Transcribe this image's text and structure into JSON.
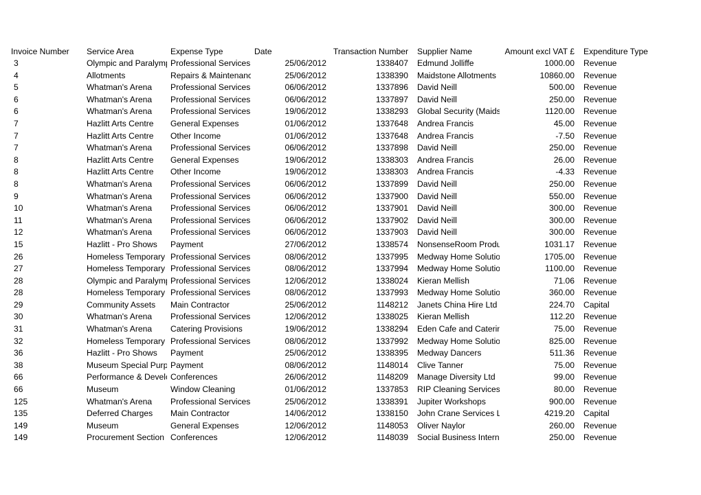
{
  "sheet": {
    "columns": [
      {
        "key": "invoice_number",
        "label": "Invoice Number",
        "align": "left"
      },
      {
        "key": "service_area",
        "label": "Service Area",
        "align": "left"
      },
      {
        "key": "expense_type",
        "label": "Expense Type",
        "align": "left"
      },
      {
        "key": "date",
        "label": "Date",
        "align": "right"
      },
      {
        "key": "transaction_no",
        "label": "Transaction Number",
        "align": "right"
      },
      {
        "key": "supplier_name",
        "label": "Supplier Name",
        "align": "left"
      },
      {
        "key": "amount_excl_vat",
        "label": "Amount excl VAT £",
        "align": "right"
      },
      {
        "key": "expenditure_type",
        "label": "Expenditure Type",
        "align": "left"
      }
    ],
    "rows": [
      [
        "3",
        "Olympic and Paralympic",
        "Professional Services",
        "25/06/2012",
        "1338407",
        "Edmund Jolliffe",
        "1000.00",
        "Revenue"
      ],
      [
        "4",
        "Allotments",
        "Repairs & Maintenance",
        "25/06/2012",
        "1338390",
        "Maidstone Allotments",
        "10860.00",
        "Revenue"
      ],
      [
        "5",
        "Whatman's Arena",
        "Professional Services",
        "06/06/2012",
        "1337896",
        "David Neill",
        "500.00",
        "Revenue"
      ],
      [
        "6",
        "Whatman's Arena",
        "Professional Services",
        "06/06/2012",
        "1337897",
        "David Neill",
        "250.00",
        "Revenue"
      ],
      [
        "6",
        "Whatman's Arena",
        "Professional Services",
        "19/06/2012",
        "1338293",
        "Global Security (Maidstone)",
        "1120.00",
        "Revenue"
      ],
      [
        "7",
        "Hazlitt Arts Centre",
        "General Expenses",
        "01/06/2012",
        "1337648",
        "Andrea Francis",
        "45.00",
        "Revenue"
      ],
      [
        "7",
        "Hazlitt Arts Centre",
        "Other Income",
        "01/06/2012",
        "1337648",
        "Andrea Francis",
        "-7.50",
        "Revenue"
      ],
      [
        "7",
        "Whatman's Arena",
        "Professional Services",
        "06/06/2012",
        "1337898",
        "David Neill",
        "250.00",
        "Revenue"
      ],
      [
        "8",
        "Hazlitt Arts Centre",
        "General Expenses",
        "19/06/2012",
        "1338303",
        "Andrea Francis",
        "26.00",
        "Revenue"
      ],
      [
        "8",
        "Hazlitt Arts Centre",
        "Other Income",
        "19/06/2012",
        "1338303",
        "Andrea Francis",
        "-4.33",
        "Revenue"
      ],
      [
        "8",
        "Whatman's Arena",
        "Professional Services",
        "06/06/2012",
        "1337899",
        "David Neill",
        "250.00",
        "Revenue"
      ],
      [
        "9",
        "Whatman's Arena",
        "Professional Services",
        "06/06/2012",
        "1337900",
        "David Neill",
        "550.00",
        "Revenue"
      ],
      [
        "10",
        "Whatman's Arena",
        "Professional Services",
        "06/06/2012",
        "1337901",
        "David Neill",
        "300.00",
        "Revenue"
      ],
      [
        "11",
        "Whatman's Arena",
        "Professional Services",
        "06/06/2012",
        "1337902",
        "David Neill",
        "300.00",
        "Revenue"
      ],
      [
        "12",
        "Whatman's Arena",
        "Professional Services",
        "06/06/2012",
        "1337903",
        "David Neill",
        "300.00",
        "Revenue"
      ],
      [
        "15",
        "Hazlitt - Pro Shows",
        "Payment",
        "27/06/2012",
        "1338574",
        "NonsenseRoom Productions",
        "1031.17",
        "Revenue"
      ],
      [
        "26",
        "Homeless Temporary",
        "Professional Services",
        "08/06/2012",
        "1337995",
        "Medway Home Solutions",
        "1705.00",
        "Revenue"
      ],
      [
        "27",
        "Homeless Temporary",
        "Professional Services",
        "08/06/2012",
        "1337994",
        "Medway Home Solutions",
        "1100.00",
        "Revenue"
      ],
      [
        "28",
        "Olympic and Paralympic",
        "Professional Services",
        "12/06/2012",
        "1338024",
        "Kieran Mellish",
        "71.06",
        "Revenue"
      ],
      [
        "28",
        "Homeless Temporary",
        "Professional Services",
        "08/06/2012",
        "1337993",
        "Medway Home Solutions",
        "360.00",
        "Revenue"
      ],
      [
        "29",
        "Community Assets",
        "Main Contractor",
        "25/06/2012",
        "1148212",
        "Janets China Hire Ltd",
        "224.70",
        "Capital"
      ],
      [
        "30",
        "Whatman's Arena",
        "Professional Services",
        "12/06/2012",
        "1338025",
        "Kieran Mellish",
        "112.20",
        "Revenue"
      ],
      [
        "31",
        "Whatman's Arena",
        "Catering Provisions",
        "19/06/2012",
        "1338294",
        "Eden Cafe and Catering",
        "75.00",
        "Revenue"
      ],
      [
        "32",
        "Homeless Temporary",
        "Professional Services",
        "08/06/2012",
        "1337992",
        "Medway Home Solutions",
        "825.00",
        "Revenue"
      ],
      [
        "36",
        "Hazlitt - Pro Shows",
        "Payment",
        "25/06/2012",
        "1338395",
        "Medway Dancers",
        "511.36",
        "Revenue"
      ],
      [
        "38",
        "Museum Special Purpose",
        "Payment",
        "08/06/2012",
        "1148014",
        "Clive Tanner",
        "75.00",
        "Revenue"
      ],
      [
        "66",
        "Performance & Development",
        "Conferences",
        "26/06/2012",
        "1148209",
        "Manage Diversity Ltd",
        "99.00",
        "Revenue"
      ],
      [
        "66",
        "Museum",
        "Window Cleaning",
        "01/06/2012",
        "1337853",
        "RIP Cleaning Services",
        "80.00",
        "Revenue"
      ],
      [
        "125",
        "Whatman's Arena",
        "Professional Services",
        "25/06/2012",
        "1338391",
        "Jupiter Workshops",
        "900.00",
        "Revenue"
      ],
      [
        "135",
        "Deferred Charges",
        "Main Contractor",
        "14/06/2012",
        "1338150",
        "John Crane Services Ltd",
        "4219.20",
        "Capital"
      ],
      [
        "149",
        "Museum",
        "General Expenses",
        "12/06/2012",
        "1148053",
        "Oliver Naylor",
        "260.00",
        "Revenue"
      ],
      [
        "149",
        "Procurement Section",
        "Conferences",
        "12/06/2012",
        "1148039",
        "Social Business International",
        "250.00",
        "Revenue"
      ]
    ]
  }
}
